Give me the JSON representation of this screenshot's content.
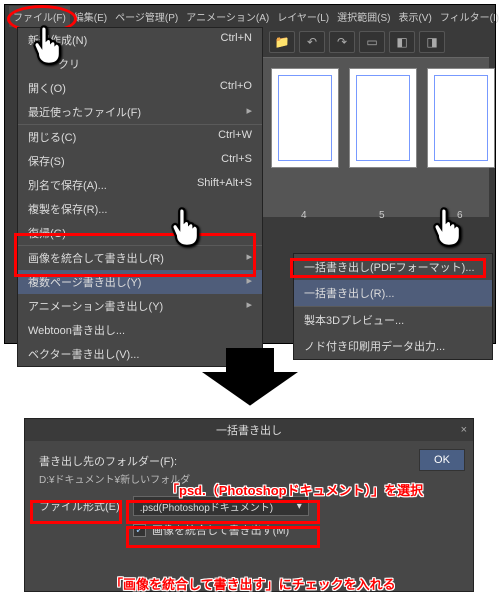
{
  "menubar": {
    "file": "ファイル(F)",
    "edit": "編集(E)",
    "page": "ページ管理(P)",
    "anim": "アニメーション(A)",
    "layer": "レイヤー(L)",
    "sel": "選択範囲(S)",
    "view": "表示(V)",
    "filter": "フィルター(I)"
  },
  "dropdown": {
    "new": "新規作成(N)",
    "new_sc": "Ctrl+N",
    "open": "開く(O)",
    "open_sc": "Ctrl+O",
    "recent": "最近使ったファイル(F)",
    "close": "閉じる(C)",
    "close_sc": "Ctrl+W",
    "save": "保存(S)",
    "save_sc": "Ctrl+S",
    "saveas": "別名で保存(A)...",
    "saveas_sc": "Shift+Alt+S",
    "savedup": "複製を保存(R)...",
    "revert": "復帰(G)",
    "merge_export": "画像を統合して書き出し(R)",
    "multi_export": "複数ページ書き出し(Y)",
    "anim_export": "アニメーション書き出し(Y)",
    "webtoon": "Webtoon書き出し...",
    "vector": "ベクター書き出し(V)..."
  },
  "pages": {
    "p4": "4",
    "p5": "5",
    "p6": "6"
  },
  "submenu": {
    "pdf": "一括書き出し(PDFフォーマット)...",
    "batch": "一括書き出し(R)...",
    "preview": "製本3Dプレビュー...",
    "print": "ノド付き印刷用データ出力..."
  },
  "dialog": {
    "title": "一括書き出し",
    "folder_label": "書き出し先のフォルダー(F):",
    "folder_path": "D:¥ドキュメント¥新しいフォルダ",
    "ok": "OK",
    "format_label": "ファイル形式(E):",
    "format_value": ".psd(Photoshopドキュメント)",
    "checkbox": "画像を統合して書き出す(M)",
    "checked": "✓"
  },
  "annotations": {
    "a1": "「psd.（Photoshopドキュメント）」を選択",
    "a2": "「画像を統合して書き出す」にチェックを入れる"
  },
  "close_x": "×",
  "dropdown_arrow": "▾"
}
